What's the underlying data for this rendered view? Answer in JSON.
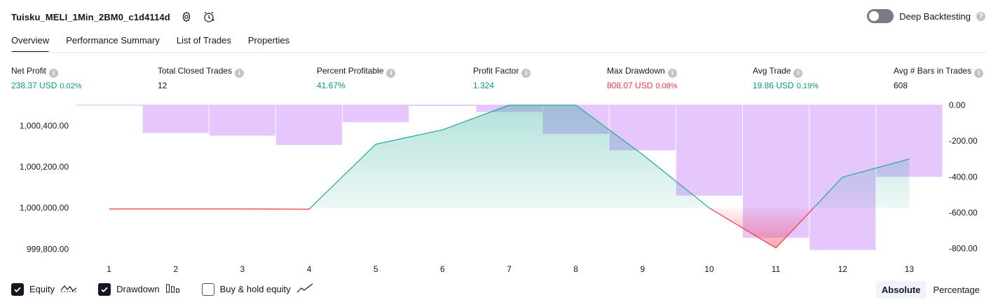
{
  "header": {
    "title": "Tuisku_MELI_1Min_2BM0_c1d4114d",
    "settings_icon": "gear-icon",
    "alert_icon": "alarm-clock-icon"
  },
  "deep_backtesting": {
    "label": "Deep Backtesting",
    "enabled": false
  },
  "tabs": [
    {
      "label": "Overview",
      "active": true
    },
    {
      "label": "Performance Summary",
      "active": false
    },
    {
      "label": "List of Trades",
      "active": false
    },
    {
      "label": "Properties",
      "active": false
    }
  ],
  "metrics": {
    "net_profit": {
      "label": "Net Profit",
      "value": "238.37 USD",
      "pct": "0.02%"
    },
    "total_closed_trades": {
      "label": "Total Closed Trades",
      "value": "12"
    },
    "percent_profitable": {
      "label": "Percent Profitable",
      "value": "41.67%"
    },
    "profit_factor": {
      "label": "Profit Factor",
      "value": "1.324"
    },
    "max_drawdown": {
      "label": "Max Drawdown",
      "value": "808.07 USD",
      "pct": "0.08%"
    },
    "avg_trade": {
      "label": "Avg Trade",
      "value": "19.86 USD",
      "pct": "0.19%"
    },
    "avg_bars": {
      "label": "Avg # Bars in Trades",
      "value": "608"
    }
  },
  "colors": {
    "positive": "#089981",
    "negative": "#f23645",
    "drawdown_bar": "#e1bcfd",
    "equity_up_line": "#22ab94",
    "equity_down_line": "#f23645"
  },
  "chart_data": {
    "type": "line",
    "x": [
      1,
      2,
      3,
      4,
      5,
      6,
      7,
      8,
      9,
      10,
      11,
      12,
      13
    ],
    "x_tick_labels": [
      "1",
      "2",
      "3",
      "4",
      "5",
      "6",
      "7",
      "8",
      "9",
      "10",
      "11",
      "12",
      "13"
    ],
    "equity": {
      "values": [
        999995,
        999995,
        999995,
        999994,
        1000310,
        1000380,
        1000500,
        1000500,
        1000260,
        1000000,
        999805,
        1000150,
        1000238
      ],
      "baseline": 1000000
    },
    "drawdown": {
      "categories": [
        2,
        3,
        4,
        5,
        6,
        7,
        8,
        9,
        10,
        11,
        12,
        13
      ],
      "values": [
        -155,
        -170,
        -222,
        -95,
        -5,
        -38,
        -160,
        -252,
        -505,
        -740,
        -808,
        -400
      ]
    },
    "left_axis": {
      "range": [
        999750,
        1000500
      ],
      "tick_values": [
        999800,
        1000000,
        1000200,
        1000400
      ],
      "tick_labels": [
        "999,800.00",
        "1,000,000.00",
        "1,000,200.00",
        "1,000,400.00"
      ]
    },
    "right_axis": {
      "range": [
        -860,
        0
      ],
      "tick_values": [
        0,
        -200,
        -400,
        -600,
        -800
      ],
      "tick_labels": [
        "0.00",
        "-200.00",
        "-400.00",
        "-600.00",
        "-800.00"
      ]
    }
  },
  "legend": {
    "equity": {
      "label": "Equity",
      "checked": true
    },
    "drawdown": {
      "label": "Drawdown",
      "checked": true
    },
    "buy_hold": {
      "label": "Buy & hold equity",
      "checked": false
    }
  },
  "mode": {
    "absolute": "Absolute",
    "percentage": "Percentage",
    "selected": "absolute"
  }
}
